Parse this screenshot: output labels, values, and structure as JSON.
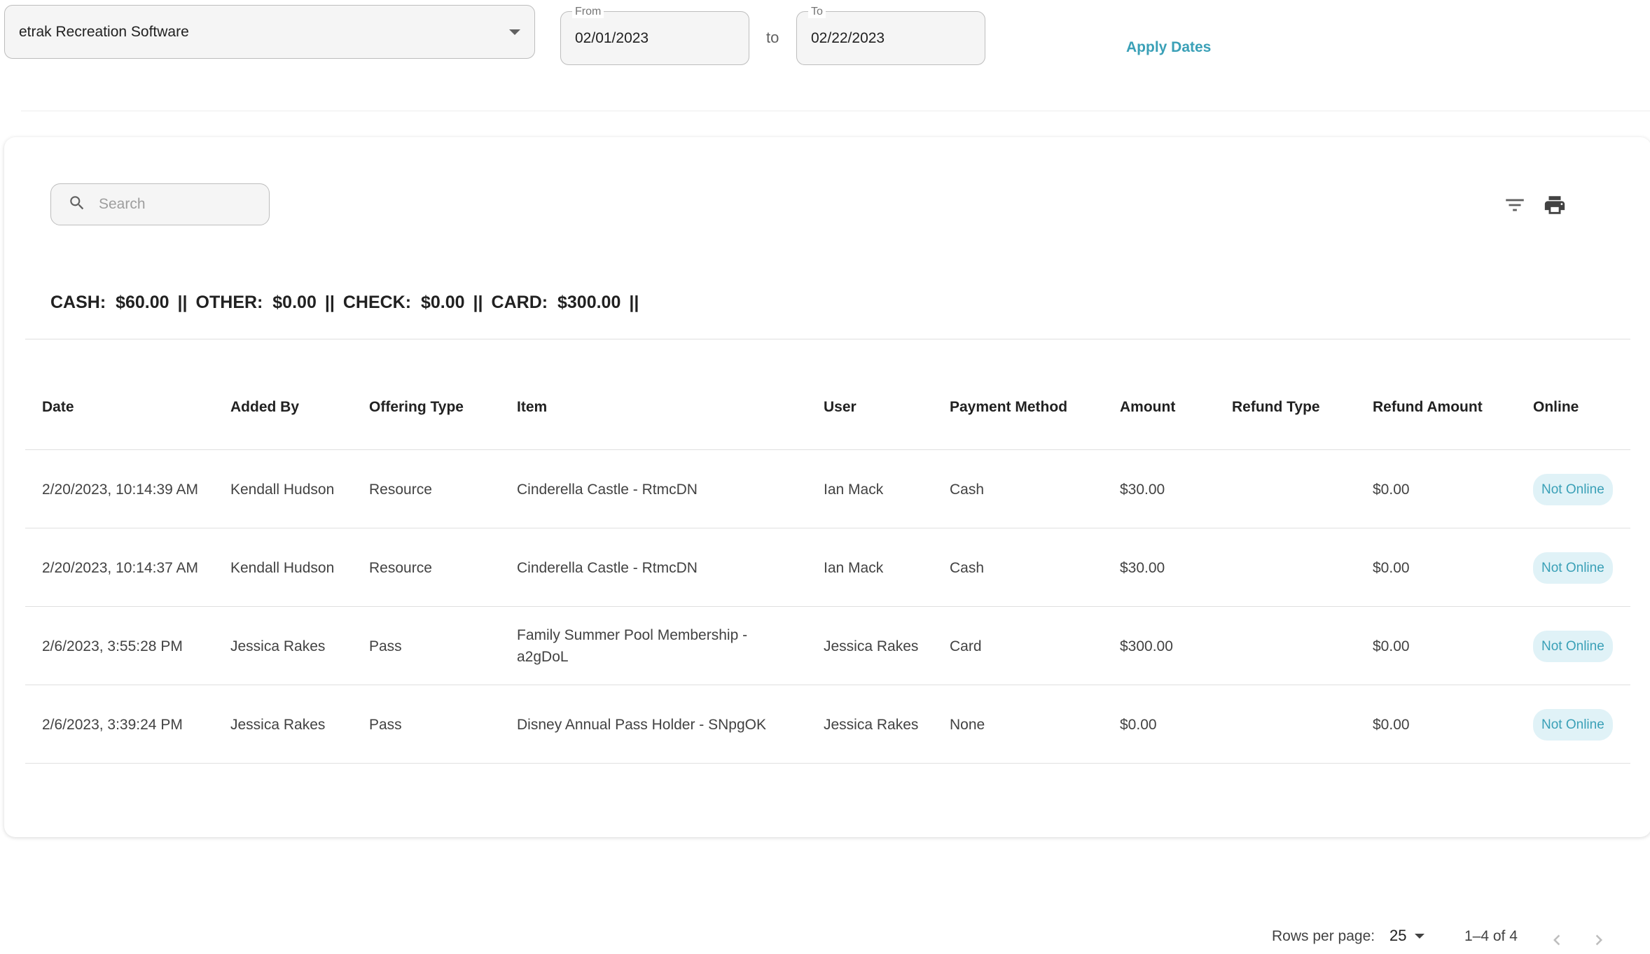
{
  "filters": {
    "organization": "etrak Recreation Software",
    "from_label": "From",
    "from_value": "02/01/2023",
    "to_text": "to",
    "to_label": "To",
    "to_value": "02/22/2023",
    "apply_label": "Apply Dates"
  },
  "search": {
    "placeholder": "Search"
  },
  "totals": {
    "cash_label": "CASH:",
    "cash_value": "$60.00",
    "other_label": "OTHER:",
    "other_value": "$0.00",
    "check_label": "CHECK:",
    "check_value": "$0.00",
    "card_label": "CARD:",
    "card_value": "$300.00",
    "separator": "||"
  },
  "table": {
    "headers": [
      "Date",
      "Added By",
      "Offering Type",
      "Item",
      "User",
      "Payment Method",
      "Amount",
      "Refund Type",
      "Refund Amount",
      "Online"
    ],
    "rows": [
      [
        "2/20/2023, 10:14:39 AM",
        "Kendall Hudson",
        "Resource",
        "Cinderella Castle - RtmcDN",
        "Ian Mack",
        "Cash",
        "$30.00",
        "",
        "$0.00",
        "Not Online"
      ],
      [
        "2/20/2023, 10:14:37 AM",
        "Kendall Hudson",
        "Resource",
        "Cinderella Castle - RtmcDN",
        "Ian Mack",
        "Cash",
        "$30.00",
        "",
        "$0.00",
        "Not Online"
      ],
      [
        "2/6/2023, 3:55:28 PM",
        "Jessica Rakes",
        "Pass",
        "Family Summer Pool Membership - a2gDoL",
        "Jessica Rakes",
        "Card",
        "$300.00",
        "",
        "$0.00",
        "Not Online"
      ],
      [
        "2/6/2023, 3:39:24 PM",
        "Jessica Rakes",
        "Pass",
        "Disney Annual Pass Holder - SNpgOK",
        "Jessica Rakes",
        "None",
        "$0.00",
        "",
        "$0.00",
        "Not Online"
      ]
    ]
  },
  "pagination": {
    "rows_per_page_label": "Rows per page:",
    "rows_per_page_value": "25",
    "range_text": "1–4 of 4"
  },
  "colors": {
    "accent": "#3aa0b7",
    "badge_bg": "#e0f2f7"
  },
  "icons": [
    "dropdown-caret-icon",
    "search-icon",
    "filter-icon",
    "print-icon",
    "chevron-left-icon",
    "chevron-right-icon"
  ]
}
